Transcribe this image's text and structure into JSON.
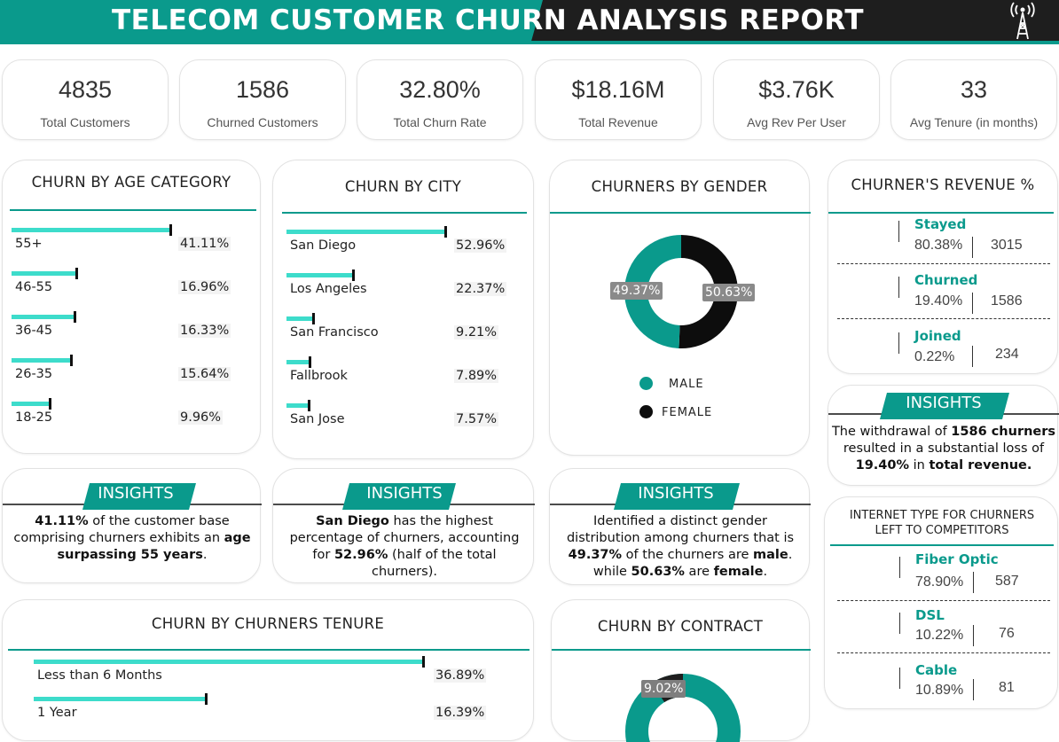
{
  "header": {
    "title": "TELECOM CUSTOMER CHURN ANALYSIS REPORT",
    "icon": "antenna-tower-icon",
    "colors": {
      "teal": "#0a9a8c",
      "dark": "#1e1e1e",
      "bar": "#3ddccb"
    }
  },
  "kpis": [
    {
      "value": "4835",
      "label": "Total Customers"
    },
    {
      "value": "1586",
      "label": "Churned Customers"
    },
    {
      "value": "32.80%",
      "label": "Total Churn Rate"
    },
    {
      "value": "$18.16M",
      "label": "Total Revenue"
    },
    {
      "value": "$3.76K",
      "label": "Avg Rev Per User"
    },
    {
      "value": "33",
      "label": "Avg Tenure (in months)"
    }
  ],
  "chart_data": [
    {
      "type": "bar",
      "title": "CHURN BY AGE CATEGORY",
      "categories": [
        "55+",
        "46-55",
        "36-45",
        "26-35",
        "18-25"
      ],
      "values": [
        41.11,
        16.96,
        16.33,
        15.64,
        9.96
      ],
      "labels": [
        "41.11%",
        "16.96%",
        "16.33%",
        "15.64%",
        "9.96%"
      ]
    },
    {
      "type": "bar",
      "title": "CHURN BY CITY",
      "categories": [
        "San Diego",
        "Los Angeles",
        "San Francisco",
        "Fallbrook",
        "San Jose"
      ],
      "values": [
        52.96,
        22.37,
        9.21,
        7.89,
        7.57
      ],
      "labels": [
        "52.96%",
        "22.37%",
        "9.21%",
        "7.89%",
        "7.57%"
      ]
    },
    {
      "type": "pie",
      "title": "CHURNERS BY GENDER",
      "categories": [
        "MALE",
        "FEMALE"
      ],
      "values": [
        49.37,
        50.63
      ],
      "labels": [
        "49.37%",
        "50.63%"
      ],
      "colors": [
        "#0a9a8c",
        "#0d0d0d"
      ]
    },
    {
      "type": "bar",
      "title": "CHURN BY CHURNERS TENURE",
      "categories": [
        "Less than 6 Months",
        "1 Year"
      ],
      "values": [
        36.89,
        16.39
      ],
      "labels": [
        "36.89%",
        "16.39%"
      ]
    },
    {
      "type": "pie",
      "title": "CHURN BY CONTRACT",
      "values": [
        9.02
      ],
      "labels": [
        "9.02%"
      ]
    }
  ],
  "revenue": {
    "title": "CHURNER'S REVENUE %",
    "items": [
      {
        "label": "Stayed",
        "pct": "80.38%",
        "count": "3015"
      },
      {
        "label": "Churned",
        "pct": "19.40%",
        "count": "1586"
      },
      {
        "label": "Joined",
        "pct": "0.22%",
        "count": "234"
      }
    ]
  },
  "internet": {
    "title_line1": "INTERNET TYPE FOR CHURNERS",
    "title_line2": "LEFT TO COMPETITORS",
    "items": [
      {
        "label": "Fiber Optic",
        "pct": "78.90%",
        "count": "587"
      },
      {
        "label": "DSL",
        "pct": "10.22%",
        "count": "76"
      },
      {
        "label": "Cable",
        "pct": "10.89%",
        "count": "81"
      }
    ]
  },
  "insights": {
    "heading": "INSIGHTS",
    "age": {
      "p1": "41.11%",
      "p2": " of the customer base comprising churners exhibits an ",
      "p3": "age surpassing 55 years",
      "p4": "."
    },
    "city": {
      "p1": "San Diego",
      "p2": " has the highest percentage of churners, accounting for ",
      "p3": "52.96%",
      "p4": " (half of the total churners)."
    },
    "gender": {
      "p1": "Identified a distinct gender distribution among churners that is ",
      "p2": "49.37%",
      "p3": " of the churners are ",
      "p4": "male",
      "p5": ". while ",
      "p6": "50.63%",
      "p7": " are ",
      "p8": "female",
      "p9": "."
    },
    "revenue": {
      "p1": "The withdrawal of ",
      "p2": "1586 churners",
      "p3": " resulted in a substantial loss of ",
      "p4": "19.40%",
      "p5": " in ",
      "p6": "total revenue."
    }
  }
}
